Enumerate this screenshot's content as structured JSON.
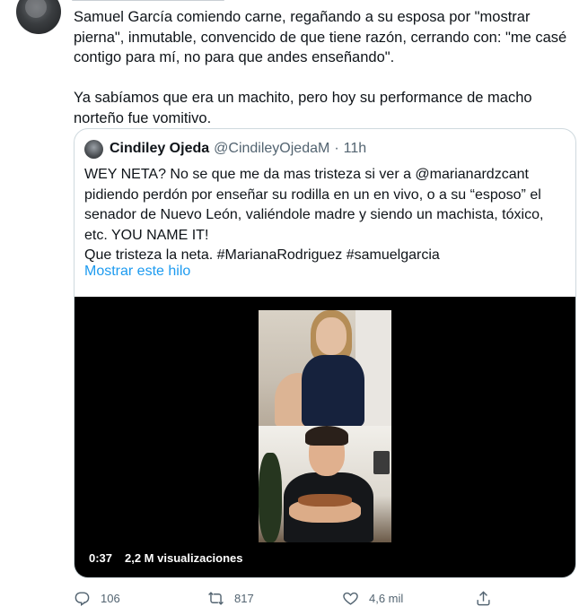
{
  "tweet": {
    "paragraphs": [
      "Samuel García comiendo carne, regañando a su esposa por \"mostrar pierna\", inmutable, convencido de que tiene razón, cerrando con: \"me casé contigo para mí, no para que andes enseñando\".",
      "Ya sabíamos que era un machito, pero hoy su performance de macho norteño fue vomitivo."
    ],
    "quote": {
      "name": "Cindiley Ojeda",
      "handle": "@CindileyOjedaM",
      "separator": "·",
      "time": "11h",
      "lines": [
        "WEY NETA? No se que me da mas tristeza si ver a @marianardzcant",
        "pidiendo perdón por enseñar su rodilla en un en vivo, o a su “esposo” el",
        "senador de Nuevo León, valiéndole madre y siendo un machista, tóxico,",
        "etc. YOU NAME IT!",
        "Que tristeza la neta. #MarianaRodriguez #samuelgarcia"
      ],
      "show_thread": "Mostrar este hilo",
      "video": {
        "duration": "0:37",
        "views": "2,2 M visualizaciones"
      }
    },
    "actions": {
      "replies": "106",
      "retweets": "817",
      "likes": "4,6 mil"
    }
  },
  "colors": {
    "link": "#1d9bf0",
    "secondary_text": "#536471",
    "border": "#cfd9de"
  },
  "icons": {
    "reply": "reply-icon",
    "retweet": "retweet-icon",
    "like": "heart-icon",
    "share": "share-icon"
  }
}
